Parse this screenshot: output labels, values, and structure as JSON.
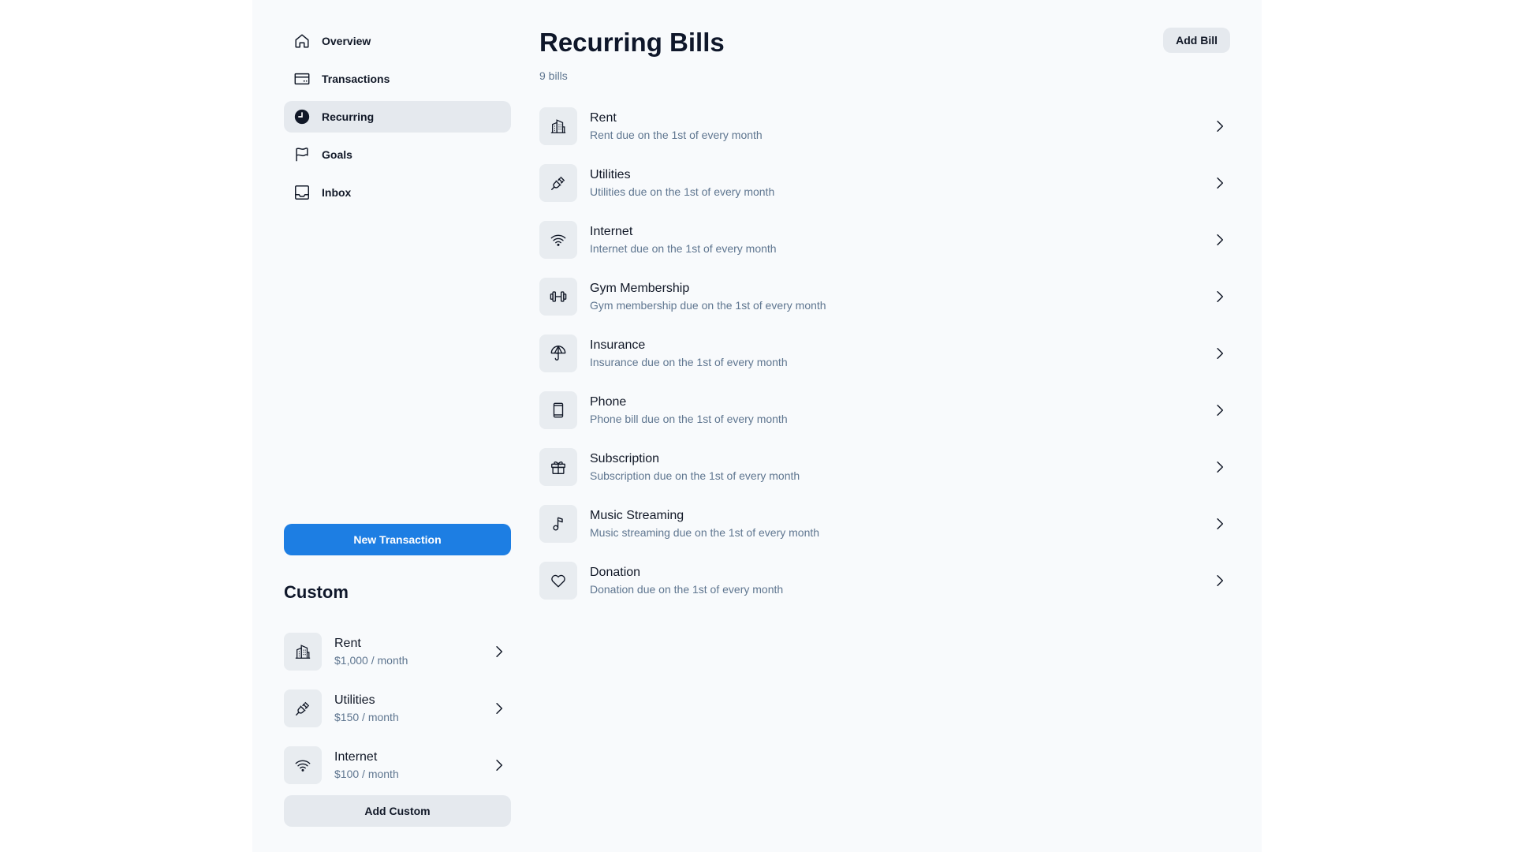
{
  "sidebar": {
    "nav": [
      {
        "label": "Overview",
        "icon": "home-icon",
        "active": false
      },
      {
        "label": "Transactions",
        "icon": "credit-card-icon",
        "active": false
      },
      {
        "label": "Recurring",
        "icon": "clock-icon",
        "active": true
      },
      {
        "label": "Goals",
        "icon": "flag-icon",
        "active": false
      },
      {
        "label": "Inbox",
        "icon": "inbox-icon",
        "active": false
      }
    ],
    "new_transaction_label": "New Transaction",
    "custom_title": "Custom",
    "custom_items": [
      {
        "title": "Rent",
        "amount": "$1,000 / month",
        "icon": "building-icon"
      },
      {
        "title": "Utilities",
        "amount": "$150 / month",
        "icon": "plug-icon"
      },
      {
        "title": "Internet",
        "amount": "$100 / month",
        "icon": "wifi-icon"
      }
    ],
    "add_custom_label": "Add Custom"
  },
  "main": {
    "title": "Recurring Bills",
    "count": "9 bills",
    "add_bill_label": "Add Bill",
    "bills": [
      {
        "title": "Rent",
        "subtitle": "Rent due on the 1st of every month",
        "icon": "building-icon"
      },
      {
        "title": "Utilities",
        "subtitle": "Utilities due on the 1st of every month",
        "icon": "plug-icon"
      },
      {
        "title": "Internet",
        "subtitle": "Internet due on the 1st of every month",
        "icon": "wifi-icon"
      },
      {
        "title": "Gym Membership",
        "subtitle": "Gym membership due on the 1st of every month",
        "icon": "dumbbell-icon"
      },
      {
        "title": "Insurance",
        "subtitle": "Insurance due on the 1st of every month",
        "icon": "umbrella-icon"
      },
      {
        "title": "Phone",
        "subtitle": "Phone bill due on the 1st of every month",
        "icon": "phone-icon"
      },
      {
        "title": "Subscription",
        "subtitle": "Subscription due on the 1st of every month",
        "icon": "gift-icon"
      },
      {
        "title": "Music Streaming",
        "subtitle": "Music streaming due on the 1st of every month",
        "icon": "music-note-icon"
      },
      {
        "title": "Donation",
        "subtitle": "Donation due on the 1st of every month",
        "icon": "heart-icon"
      }
    ]
  },
  "colors": {
    "accent": "#1d7ee3",
    "app_background": "#f8fafc",
    "active_nav": "#e5e9ee",
    "muted_text": "#5f7690"
  }
}
